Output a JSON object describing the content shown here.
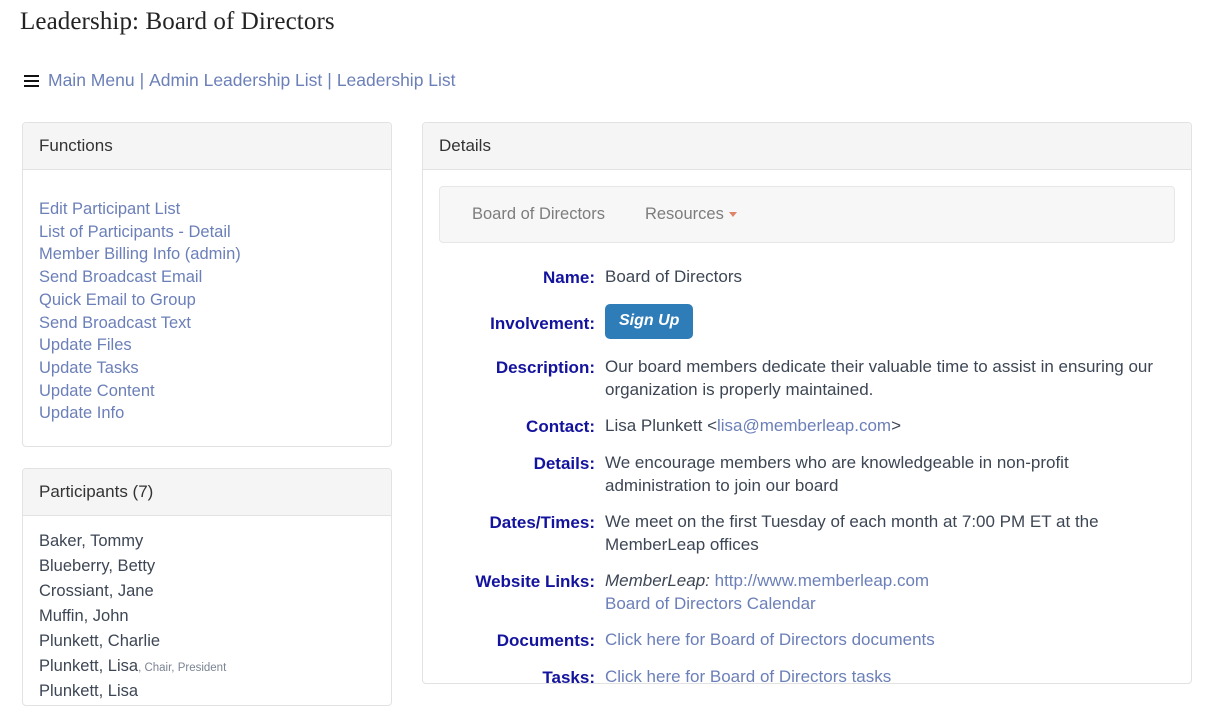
{
  "page": {
    "title": "Leadership: Board of Directors"
  },
  "breadcrumb": {
    "menu_icon": "hamburger-icon",
    "separator": "|",
    "items": [
      {
        "label": "Main Menu"
      },
      {
        "label": "Admin Leadership List"
      },
      {
        "label": "Leadership List"
      }
    ]
  },
  "functions_panel": {
    "heading": "Functions",
    "links": [
      {
        "label": "Edit Participant List"
      },
      {
        "label": "List of Participants - Detail"
      },
      {
        "label": "Member Billing Info (admin)"
      },
      {
        "label": "Send Broadcast Email"
      },
      {
        "label": "Quick Email to Group"
      },
      {
        "label": "Send Broadcast Text"
      },
      {
        "label": "Update Files"
      },
      {
        "label": "Update Tasks"
      },
      {
        "label": "Update Content"
      },
      {
        "label": "Update Info"
      }
    ]
  },
  "participants_panel": {
    "heading": "Participants (7)",
    "count": 7,
    "items": [
      {
        "name": "Baker, Tommy",
        "role": ""
      },
      {
        "name": "Blueberry, Betty",
        "role": ""
      },
      {
        "name": "Crossiant, Jane",
        "role": ""
      },
      {
        "name": "Muffin, John",
        "role": ""
      },
      {
        "name": "Plunkett, Charlie",
        "role": ""
      },
      {
        "name": "Plunkett, Lisa",
        "role": ", Chair, President"
      },
      {
        "name": "Plunkett, Lisa",
        "role": ""
      }
    ]
  },
  "details_panel": {
    "heading": "Details",
    "nav": {
      "tab_label": "Board of Directors",
      "dropdown_label": "Resources",
      "caret_icon": "caret-down-icon"
    },
    "rows": {
      "name": {
        "label": "Name:",
        "value": "Board of Directors"
      },
      "involvement": {
        "label": "Involvement:",
        "button_label": "Sign Up"
      },
      "description": {
        "label": "Description:",
        "value": "Our board members dedicate their valuable time to assist in ensuring our organization is properly maintained."
      },
      "contact": {
        "label": "Contact:",
        "person": "Lisa Plunkett",
        "open_bracket": "‹",
        "email": "lisa@memberleap.com",
        "close_bracket": "›"
      },
      "details": {
        "label": "Details:",
        "value": "We encourage members who are knowledgeable in non-profit administration to join our board"
      },
      "dates_times": {
        "label": "Dates/Times:",
        "value": "We meet on the first Tuesday of each month at 7:00 PM ET at the MemberLeap offices"
      },
      "website_links": {
        "label": "Website Links:",
        "site_name": "MemberLeap:",
        "url": "http://www.memberleap.com",
        "calendar_link": "Board of Directors Calendar"
      },
      "documents": {
        "label": "Documents:",
        "link": "Click here for Board of Directors documents"
      },
      "tasks": {
        "label": "Tasks:",
        "link": "Click here for Board of Directors tasks"
      }
    }
  },
  "colors": {
    "link": "#6b7fb8",
    "label": "#13139e",
    "button": "#2e7cb8",
    "caret": "#e08368",
    "panel_head_bg": "#f5f5f5",
    "border": "#e2e2e2",
    "text": "#3d4654"
  }
}
